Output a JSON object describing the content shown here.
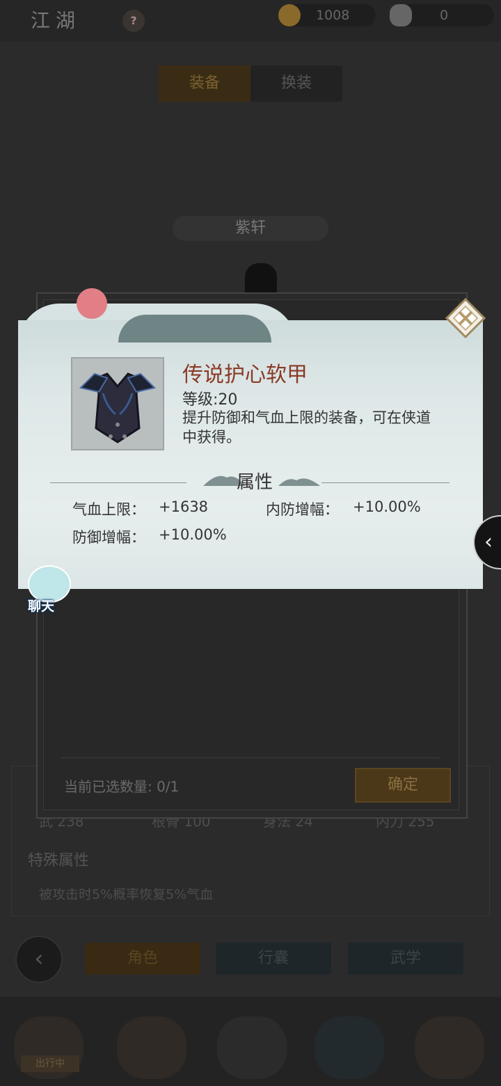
{
  "header": {
    "title": "江湖",
    "help_icon": "question-mark-icon",
    "currency": [
      {
        "icon": "copper-coin-icon",
        "value": "1008"
      },
      {
        "icon": "silver-ingot-icon",
        "value": "0"
      }
    ]
  },
  "tabs": {
    "equip": "装备",
    "change": "换装"
  },
  "character_name": "紫轩",
  "select_panel": {
    "selected_label": "当前已选数量: 0/1",
    "confirm": "确定"
  },
  "stats_row": [
    "武 238",
    "根骨 100",
    "身法 24",
    "内力 255"
  ],
  "special": {
    "title": "特殊属性",
    "desc": "被攻击时5%概率恢复5%气血"
  },
  "bottom_tabs": {
    "role": "角色",
    "bag": "行囊",
    "martial": "武学"
  },
  "bottom_nav": {
    "badge": "出行中"
  },
  "modal": {
    "item_name": "传说护心软甲",
    "item_level": "等级:20",
    "item_desc": "提升防御和气血上限的装备，可在侠道中获得。",
    "attr_title": "属性",
    "attributes": [
      {
        "label": "气血上限：",
        "value": "+1638"
      },
      {
        "label": "内防增幅：",
        "value": "+10.00%"
      },
      {
        "label": "防御增幅：",
        "value": "+10.00%"
      }
    ],
    "close_icon": "diamond-close-icon"
  },
  "chat": {
    "label": "聊天"
  },
  "colors": {
    "item_name": "#8a3a26",
    "modal_bg": "#dfe8e8"
  }
}
